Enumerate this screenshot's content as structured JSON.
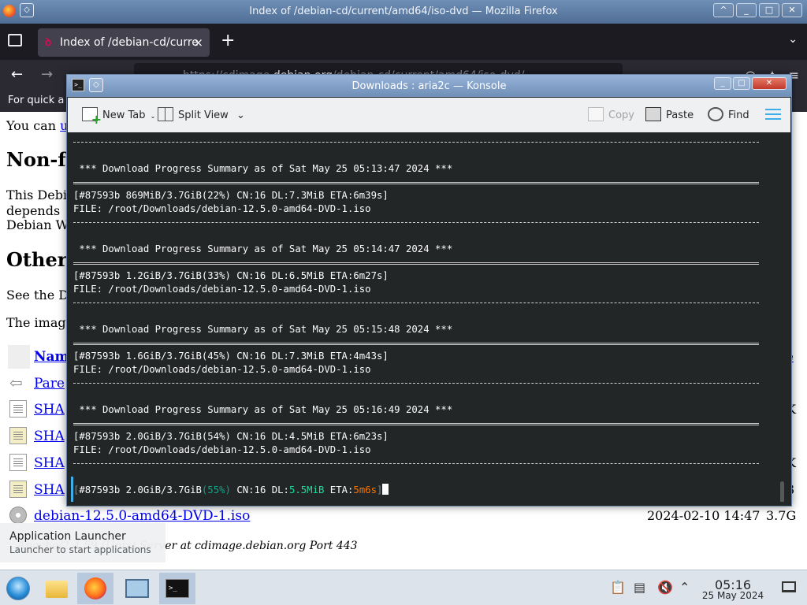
{
  "firefox": {
    "window_title": "Index of /debian-cd/current/amd64/iso-dvd — Mozilla Firefox",
    "tab_label": "Index of /debian-cd/curre",
    "url_prefix": "https://cdimage.",
    "url_domain": "debian.org",
    "url_path": "/debian-cd/current/amd64/iso-dvd/",
    "bookmarks_hint": "For quick a",
    "page": {
      "line_you_can": "You can",
      "you_can_link": "u",
      "heading_nonfree": "Non-fr",
      "para_line1": "This Debi",
      "para_line2": "depends",
      "para_line3": "Debian W",
      "heading_other": "Other",
      "see_the": "See the D",
      "the_image": "The image",
      "col_name": "Nam",
      "col_right_link": "e",
      "parent": "Pare",
      "rows": [
        {
          "name": "SHA",
          "right": "K"
        },
        {
          "name": "SHA",
          "right": ""
        },
        {
          "name": "SHA",
          "right": "K"
        },
        {
          "name": "SHA",
          "right": "3"
        }
      ],
      "iso_name": "debian-12.5.0-amd64-DVD-1.iso",
      "iso_date": "2024-02-10 14:47",
      "iso_size": "3.7G",
      "footer": "Apache/2.4.59 (Unix) Server at cdimage.debian.org Port 443"
    }
  },
  "konsole": {
    "title": "Downloads : aria2c — Konsole",
    "toolbar": {
      "new_tab": "New Tab",
      "split_view": "Split View",
      "copy": "Copy",
      "paste": "Paste",
      "find": "Find"
    },
    "terminal": {
      "summaries": [
        {
          "header": " *** Download Progress Summary as of Sat May 25 05:13:47 2024 ***",
          "progress": "[#87593b 869MiB/3.7GiB(22%) CN:16 DL:7.3MiB ETA:6m39s]",
          "file": "FILE: /root/Downloads/debian-12.5.0-amd64-DVD-1.iso"
        },
        {
          "header": " *** Download Progress Summary as of Sat May 25 05:14:47 2024 ***",
          "progress": "[#87593b 1.2GiB/3.7GiB(33%) CN:16 DL:6.5MiB ETA:6m27s]",
          "file": "FILE: /root/Downloads/debian-12.5.0-amd64-DVD-1.iso"
        },
        {
          "header": " *** Download Progress Summary as of Sat May 25 05:15:48 2024 ***",
          "progress": "[#87593b 1.6GiB/3.7GiB(45%) CN:16 DL:7.3MiB ETA:4m43s]",
          "file": "FILE: /root/Downloads/debian-12.5.0-amd64-DVD-1.iso"
        },
        {
          "header": " *** Download Progress Summary as of Sat May 25 05:16:49 2024 ***",
          "progress": "[#87593b 2.0GiB/3.7GiB(54%) CN:16 DL:4.5MiB ETA:6m23s]",
          "file": "FILE: /root/Downloads/debian-12.5.0-amd64-DVD-1.iso"
        }
      ],
      "live": {
        "open": "[",
        "main": "#87593b 2.0GiB/3.7GiB",
        "pct": "(55%)",
        "cn": " CN:16 DL:",
        "dl": "5.5MiB",
        "eta_label": " ETA:",
        "eta": "5m6s",
        "close": "]"
      }
    }
  },
  "launcher_tooltip": {
    "title": "Application Launcher",
    "subtitle": "Launcher to start applications"
  },
  "taskbar": {
    "time": "05:16",
    "date": "25 May 2024"
  },
  "colors": {
    "konsole_bg": "#232627",
    "accent_blue": "#3daee9",
    "progress_green": "#1cdc9a",
    "eta_orange": "#f67400"
  }
}
